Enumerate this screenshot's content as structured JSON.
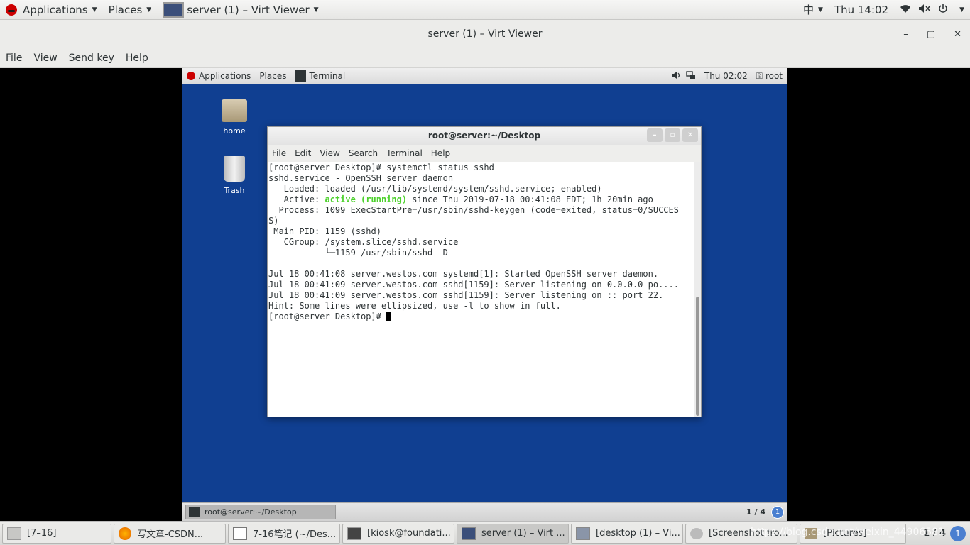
{
  "host_panel": {
    "applications": "Applications",
    "places": "Places",
    "active_window": "server (1) – Virt Viewer",
    "input_method": "中",
    "clock": "Thu 14:02"
  },
  "window": {
    "title": "server (1) – Virt Viewer",
    "minimize": "–",
    "maximize": "▢",
    "close": "✕"
  },
  "viewer_menu": [
    "File",
    "View",
    "Send key",
    "Help"
  ],
  "guest": {
    "panel": {
      "applications": "Applications",
      "places": "Places",
      "terminal": "Terminal",
      "clock": "Thu 02:02",
      "user": "root"
    },
    "desktop_icons": {
      "home": "home",
      "trash": "Trash"
    },
    "terminal": {
      "title": "root@server:~/Desktop",
      "menu": [
        "File",
        "Edit",
        "View",
        "Search",
        "Terminal",
        "Help"
      ],
      "lines": {
        "l1": "[root@server Desktop]# systemctl status sshd",
        "l2": "sshd.service - OpenSSH server daemon",
        "l3": "   Loaded: loaded (/usr/lib/systemd/system/sshd.service; enabled)",
        "l4_pre": "   Active: ",
        "l4_status": "active (running)",
        "l4_post": " since Thu 2019-07-18 00:41:08 EDT; 1h 20min ago",
        "l5": "  Process: 1099 ExecStartPre=/usr/sbin/sshd-keygen (code=exited, status=0/SUCCES",
        "l6": "S)",
        "l7": " Main PID: 1159 (sshd)",
        "l8": "   CGroup: /system.slice/sshd.service",
        "l9": "           └─1159 /usr/sbin/sshd -D",
        "l10": "",
        "l11": "Jul 18 00:41:08 server.westos.com systemd[1]: Started OpenSSH server daemon.",
        "l12": "Jul 18 00:41:09 server.westos.com sshd[1159]: Server listening on 0.0.0.0 po....",
        "l13": "Jul 18 00:41:09 server.westos.com sshd[1159]: Server listening on :: port 22.",
        "l14": "Hint: Some lines were ellipsized, use -l to show in full.",
        "l15": "[root@server Desktop]# "
      }
    },
    "bottom": {
      "task": "root@server:~/Desktop",
      "workspace": "1 / 4",
      "indicator": "1"
    }
  },
  "host_taskbar": {
    "items": [
      "[7–16]",
      "写文章-CSDN...",
      "7-16笔记 (~/Des...",
      "[kiosk@foundati...",
      "server (1) – Virt ...",
      "[desktop (1) – Vi...",
      "[Screenshot fro...",
      "[Pictures]"
    ],
    "workspace": "1 / 4",
    "indicator": "1"
  },
  "watermark": "https://blog.csdn.net/weixin_44906581",
  "colors": {
    "guest_desktop": "#103f91",
    "terminal_active": "#4bd12a",
    "indicator_blue": "#4a7fd0"
  }
}
